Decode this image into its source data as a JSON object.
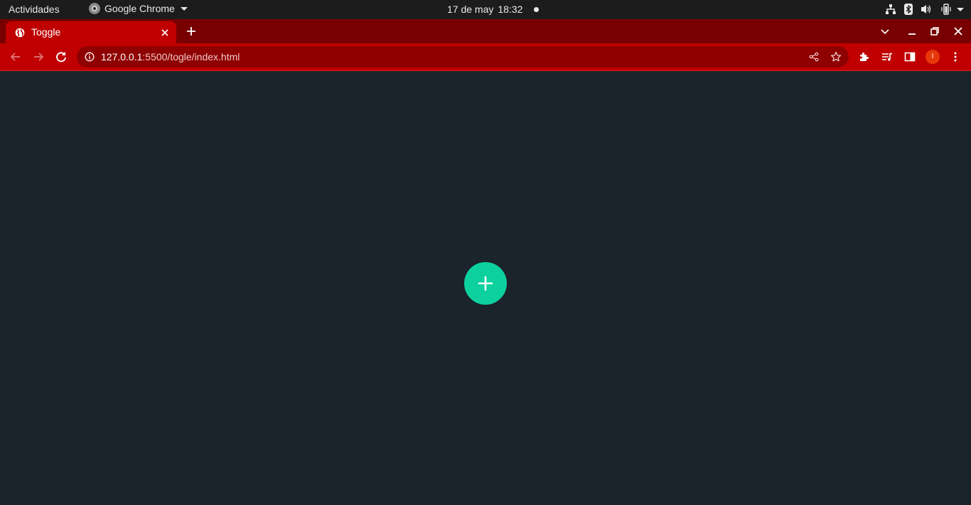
{
  "os_bar": {
    "activities": "Actividades",
    "app_name": "Google Chrome",
    "date": "17 de may",
    "time": "18:32"
  },
  "browser": {
    "tab_title": "Toggle",
    "url_host": "127.0.0.1",
    "url_path": ":5500/togle/index.html",
    "profile_initial": "I"
  },
  "page": {
    "fab_icon": "plus-icon",
    "fab_color": "#0cd19e",
    "background_color": "#1b232b"
  },
  "theme": {
    "chrome_frame": "#780000",
    "chrome_toolbar": "#c00000",
    "omnibox": "#8f0000"
  }
}
